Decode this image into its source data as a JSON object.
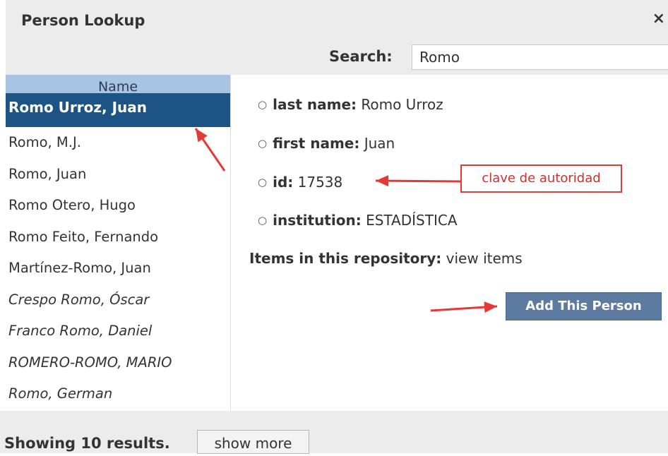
{
  "dialog": {
    "title": "Person Lookup",
    "close_glyph": "×"
  },
  "search": {
    "label": "Search:",
    "value": "Romo"
  },
  "results": {
    "column_header": "Name",
    "rows": [
      {
        "name": "Romo Urroz, Juan",
        "selected": true,
        "italic": false
      },
      {
        "name": "Romo, M.J.",
        "selected": false,
        "italic": false
      },
      {
        "name": "Romo, Juan",
        "selected": false,
        "italic": false
      },
      {
        "name": "Romo Otero, Hugo",
        "selected": false,
        "italic": false
      },
      {
        "name": "Romo Feito, Fernando",
        "selected": false,
        "italic": false
      },
      {
        "name": "Martínez-Romo, Juan",
        "selected": false,
        "italic": false
      },
      {
        "name": "Crespo Romo, Óscar",
        "selected": false,
        "italic": true
      },
      {
        "name": "Franco Romo, Daniel",
        "selected": false,
        "italic": true
      },
      {
        "name": "ROMERO-ROMO, MARIO",
        "selected": false,
        "italic": true
      },
      {
        "name": "Romo, German",
        "selected": false,
        "italic": true
      }
    ]
  },
  "details": {
    "fields": [
      {
        "label": "last name:",
        "value": "Romo Urroz"
      },
      {
        "label": "first name:",
        "value": "Juan"
      },
      {
        "label": "id:",
        "value": "17538"
      },
      {
        "label": "institution:",
        "value": "ESTADÍSTICA"
      }
    ],
    "items_label": "Items in this repository:",
    "items_link": "view items",
    "add_button": "Add This Person"
  },
  "annotation": {
    "callout_text": "clave de autoridad",
    "arrow_color": "#e53935"
  },
  "footer": {
    "showing_text": "Showing 10 results.",
    "show_more_label": "show more"
  }
}
